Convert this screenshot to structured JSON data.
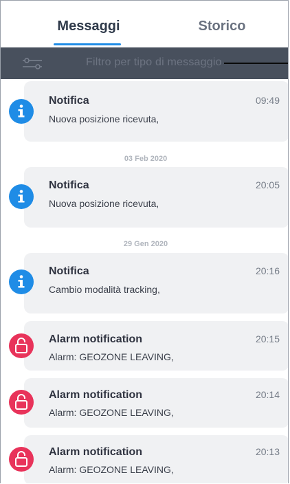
{
  "tabs": {
    "messages": "Messaggi",
    "history": "Storico"
  },
  "filter": {
    "placeholder": "Filtro per tipo di messaggio"
  },
  "dates": {
    "d1": "03 Feb 2020",
    "d2": "29 Gen 2020"
  },
  "messages": [
    {
      "type": "info",
      "title": "Notifica",
      "body": "Nuova posizione ricevuta,",
      "time": "09:49"
    },
    {
      "type": "info",
      "title": "Notifica",
      "body": "Nuova posizione ricevuta,",
      "time": "20:05"
    },
    {
      "type": "info",
      "title": "Notifica",
      "body": "Cambio modalità tracking,",
      "time": "20:16"
    },
    {
      "type": "alarm",
      "title": "Alarm notification",
      "body": "Alarm: GEOZONE LEAVING,",
      "time": "20:15"
    },
    {
      "type": "alarm",
      "title": "Alarm notification",
      "body": "Alarm: GEOZONE LEAVING,",
      "time": "20:14"
    },
    {
      "type": "alarm",
      "title": "Alarm notification",
      "body": "Alarm: GEOZONE LEAVING,",
      "time": "20:13"
    }
  ],
  "colors": {
    "accent": "#1f8ce6",
    "alarm": "#e8335a",
    "filter_bar": "#48505d"
  }
}
